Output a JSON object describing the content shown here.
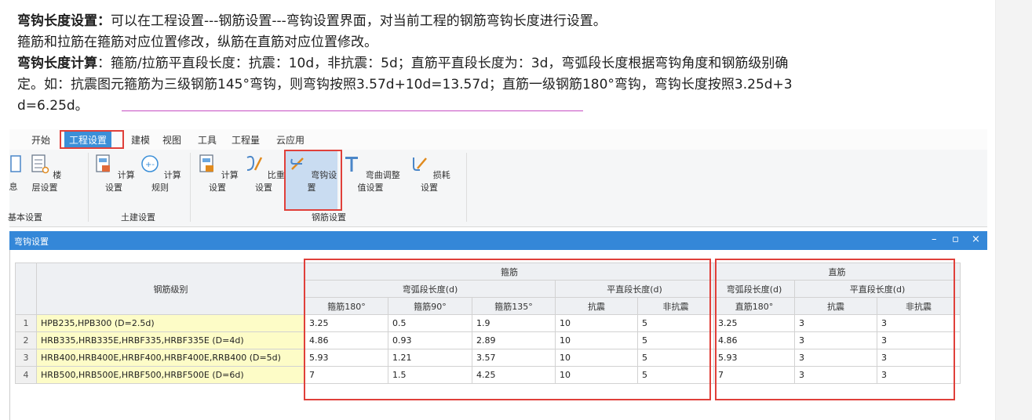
{
  "intro": {
    "line1_label": "弯钩长度设置：",
    "line1_text": "可以在工程设置---钢筋设置---弯钩设置界面，对当前工程的钢筋弯钩长度进行设置。",
    "line2_text": "箍筋和拉筋在箍筋对应位置修改，纵筋在直筋对应位置修改。",
    "line3_label": "弯钩长度计算",
    "line3_text": "：箍筋/拉筋平直段长度：抗震：10d，非抗震：5d；直筋平直段长度为：3d，弯弧段长度根据弯钩角度和钢筋级别确",
    "line4_text": "定。如：抗震图元箍筋为三级钢筋145°弯钩，则弯钩按照3.57d+10d=13.57d；直筋一级钢筋180°弯钩，弯钩长度按照3.25d+3",
    "line5_text": "d=6.25d。"
  },
  "menu": {
    "tabs": [
      "开始",
      "工程设置",
      "建模",
      "视图",
      "工具",
      "工程量",
      "云应用"
    ],
    "active_tab": "工程设置"
  },
  "ribbon": {
    "buttons": [
      "息",
      "楼层设置",
      "计算设置",
      "计算规则",
      "计算设置",
      "比重设置",
      "弯钩设置",
      "弯曲调整值设置",
      "损耗设置"
    ],
    "groups": [
      "基本设置",
      "土建设置",
      "钢筋设置"
    ]
  },
  "dialog": {
    "title": "弯钩设置",
    "controls": [
      "–",
      "▫",
      "×"
    ]
  },
  "table": {
    "col_grade": "钢筋级别",
    "stirrup_header": "箍筋",
    "straight_header": "直筋",
    "arc_length": "弯弧段长度(d)",
    "flat_length": "平直段长度(d)",
    "stirrup_arc_cols": [
      "箍筋180°",
      "箍筋90°",
      "箍筋135°"
    ],
    "stirrup_flat_cols": [
      "抗震",
      "非抗震"
    ],
    "straight_arc_cols": [
      "直筋180°"
    ],
    "straight_flat_cols": [
      "抗震",
      "非抗震"
    ],
    "rows": [
      {
        "idx": "1",
        "grade": "HPB235,HPB300 (D=2.5d)",
        "v": [
          "3.25",
          "0.5",
          "1.9",
          "10",
          "5",
          "3.25",
          "3",
          "3"
        ]
      },
      {
        "idx": "2",
        "grade": "HRB335,HRB335E,HRBF335,HRBF335E (D=4d)",
        "v": [
          "4.86",
          "0.93",
          "2.89",
          "10",
          "5",
          "4.86",
          "3",
          "3"
        ]
      },
      {
        "idx": "3",
        "grade": "HRB400,HRB400E,HRBF400,HRBF400E,RRB400 (D=5d)",
        "v": [
          "5.93",
          "1.21",
          "3.57",
          "10",
          "5",
          "5.93",
          "3",
          "3"
        ]
      },
      {
        "idx": "4",
        "grade": "HRB500,HRB500E,HRBF500,HRBF500E (D=6d)",
        "v": [
          "7",
          "1.5",
          "4.25",
          "10",
          "5",
          "7",
          "3",
          "3"
        ]
      }
    ]
  },
  "colors": {
    "highlight_red": "#e0403a",
    "title_blue": "#3487d8",
    "active_tab_blue": "#3b8fd8",
    "grade_yellow": "#fdfcc7",
    "underline_purple": "#c64cc3"
  }
}
